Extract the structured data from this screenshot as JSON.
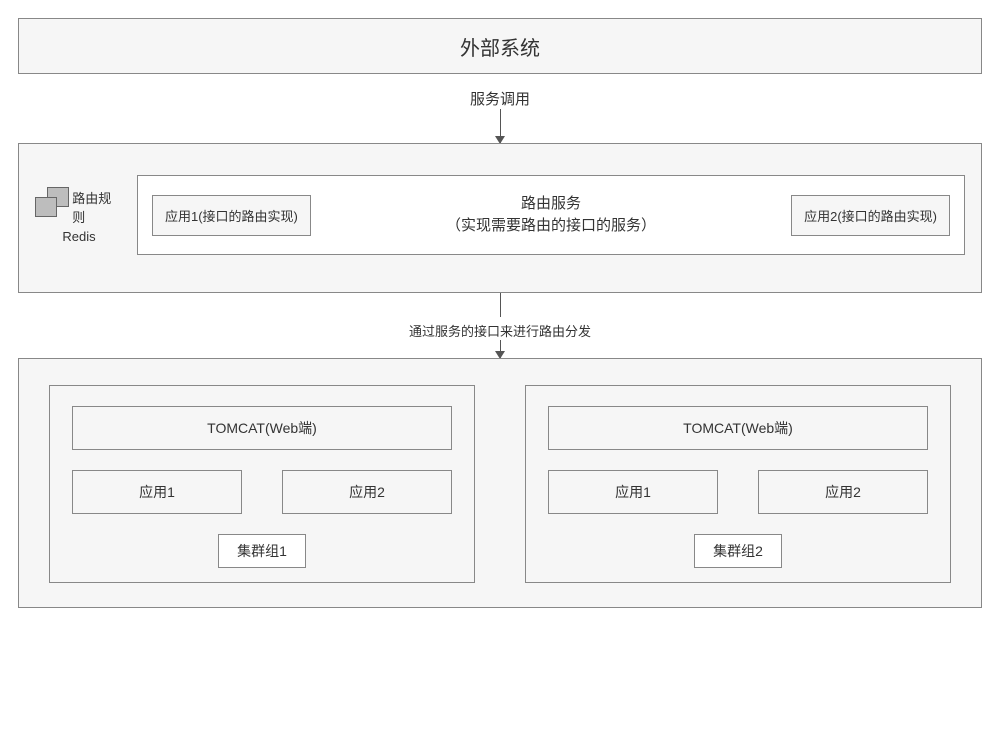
{
  "top": {
    "title": "外部系统"
  },
  "arrow1": {
    "label": "服务调用"
  },
  "middle": {
    "redis": {
      "rule": "路由规则",
      "name": "Redis"
    },
    "app1": "应用1(接口的路由实现)",
    "router_line1": "路由服务",
    "router_line2": "（实现需要路由的接口的服务）",
    "app2": "应用2(接口的路由实现)"
  },
  "arrow2": {
    "label": "通过服务的接口来进行路由分发"
  },
  "clusters": [
    {
      "tomcat": "TOMCAT(Web端)",
      "app1": "应用1",
      "app2": "应用2",
      "label": "集群组1"
    },
    {
      "tomcat": "TOMCAT(Web端)",
      "app1": "应用1",
      "app2": "应用2",
      "label": "集群组2"
    }
  ]
}
